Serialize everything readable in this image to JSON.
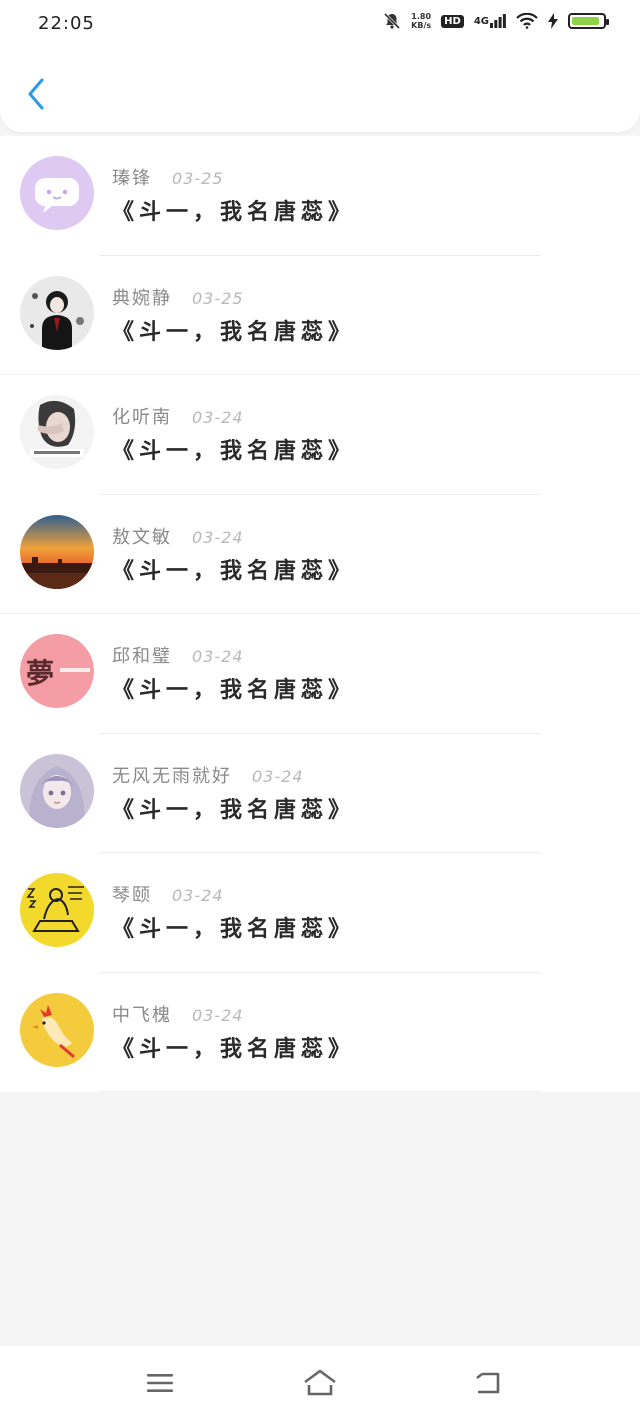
{
  "status_bar": {
    "time": "22:05",
    "net_speed_value": "1.80",
    "net_speed_unit": "KB/s",
    "hd_label": "HD",
    "network_label": "4G",
    "icons": [
      "mute-bell-icon",
      "hd-icon",
      "signal-icon",
      "wifi-icon",
      "charging-icon",
      "battery-icon"
    ],
    "battery_level": 0.9
  },
  "header": {
    "back_icon": "chevron-left-icon",
    "accent": "#2a9ae5"
  },
  "messages": [
    {
      "name": "瑧锋",
      "date": "03-25",
      "text": "《斗一，我名唐蕊》",
      "avatar": "chat-bubble-avatar"
    },
    {
      "name": "典婉静",
      "date": "03-25",
      "text": "《斗一，我名唐蕊》",
      "avatar": "boy-avatar"
    },
    {
      "name": "化听南",
      "date": "03-24",
      "text": "《斗一，我名唐蕊》",
      "avatar": "girl-avatar"
    },
    {
      "name": "敖文敏",
      "date": "03-24",
      "text": "《斗一，我名唐蕊》",
      "avatar": "sunset-avatar"
    },
    {
      "name": "邱和璧",
      "date": "03-24",
      "text": "《斗一，我名唐蕊》",
      "avatar": "dream-text-avatar",
      "avatar_char": "夢"
    },
    {
      "name": "无风无雨就好",
      "date": "03-24",
      "text": "《斗一，我名唐蕊》",
      "avatar": "anime-girl-avatar"
    },
    {
      "name": "琴颐",
      "date": "03-24",
      "text": "《斗一，我名唐蕊》",
      "avatar": "doodle-avatar"
    },
    {
      "name": "中飞槐",
      "date": "03-24",
      "text": "《斗一，我名唐蕊》",
      "avatar": "chick-avatar"
    }
  ],
  "nav_bar": {
    "icons": [
      "menu-icon",
      "home-icon",
      "back-icon"
    ]
  }
}
